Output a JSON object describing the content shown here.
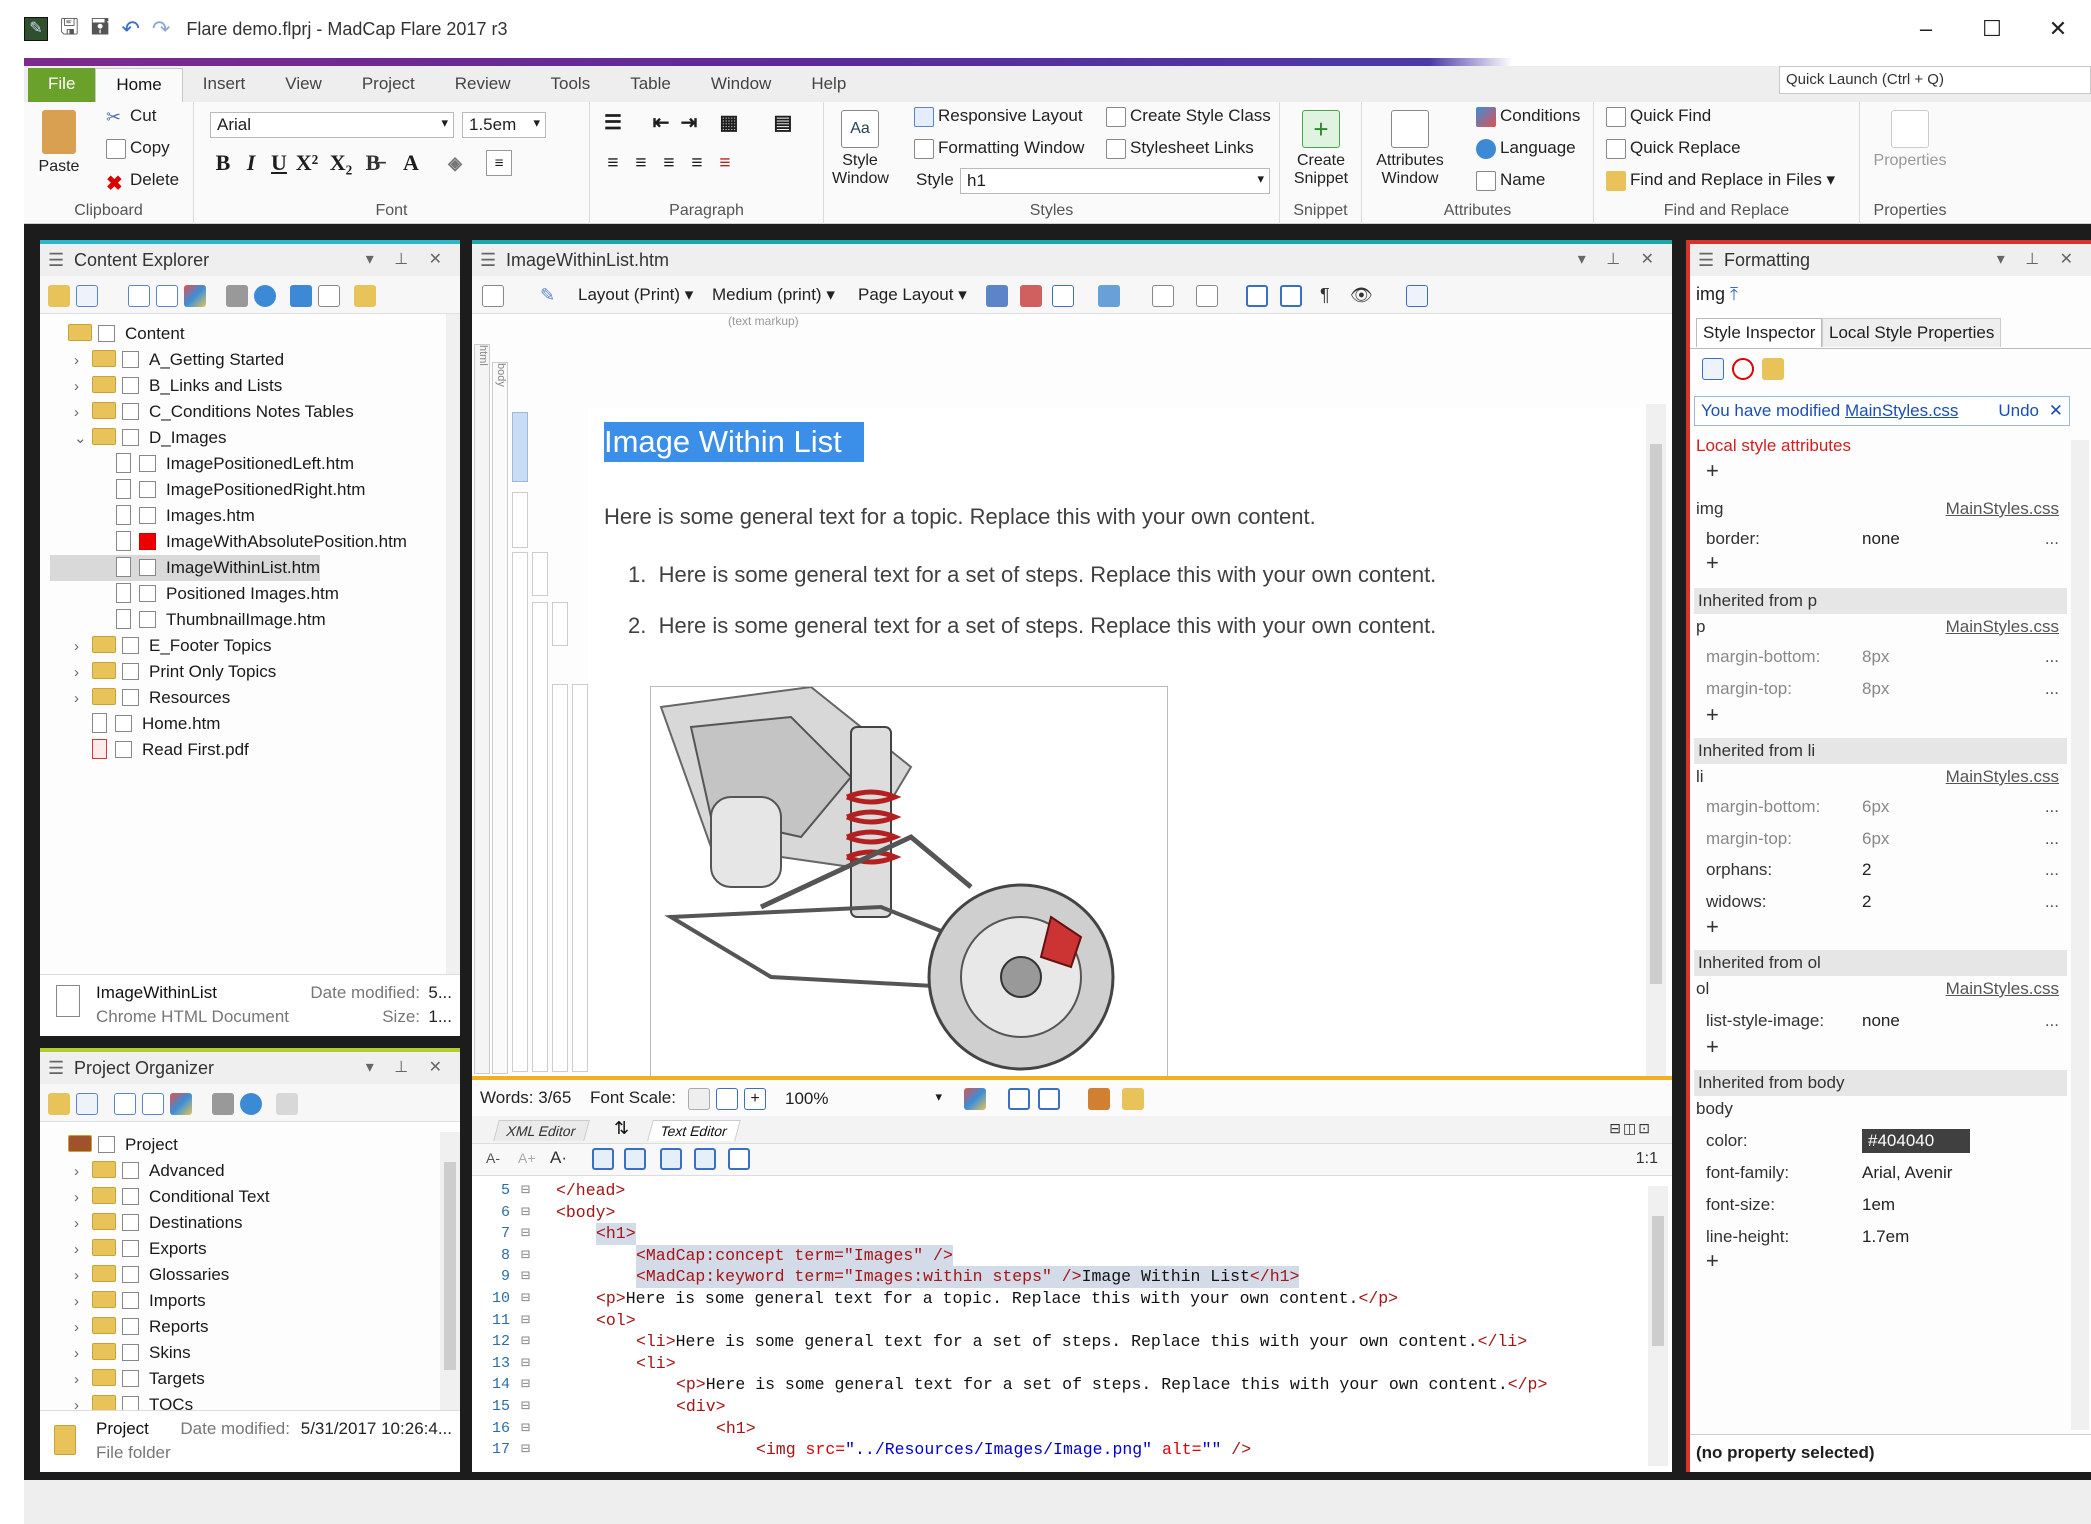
{
  "window": {
    "title": "Flare demo.flprj - MadCap Flare 2017 r3",
    "min": "–",
    "max": "☐",
    "close": "✕"
  },
  "tabs": [
    "File",
    "Home",
    "Insert",
    "View",
    "Project",
    "Review",
    "Tools",
    "Table",
    "Window",
    "Help"
  ],
  "quick_launch": "Quick Launch (Ctrl + Q)",
  "ribbon": {
    "clipboard": {
      "paste": "Paste",
      "cut": "Cut",
      "copy": "Copy",
      "delete": "Delete",
      "label": "Clipboard"
    },
    "font": {
      "family": "Arial",
      "size": "1.5em",
      "label": "Font"
    },
    "paragraph": {
      "label": "Paragraph"
    },
    "styles": {
      "style_window": "Style Window",
      "responsive": "Responsive Layout",
      "formatting": "Formatting Window",
      "create_class": "Create Style Class",
      "stylesheet_links": "Stylesheet Links",
      "style_label": "Style",
      "style_value": "h1",
      "label": "Styles"
    },
    "snippet": {
      "create": "Create Snippet",
      "label": "Snippet"
    },
    "attributes": {
      "window": "Attributes Window",
      "conditions": "Conditions",
      "language": "Language",
      "name": "Name",
      "label": "Attributes"
    },
    "find": {
      "quick_find": "Quick Find",
      "quick_replace": "Quick Replace",
      "find_files": "Find and Replace in Files",
      "label": "Find and Replace"
    },
    "properties": {
      "btn": "Properties",
      "label": "Properties"
    }
  },
  "content_explorer": {
    "title": "Content Explorer",
    "items": [
      {
        "label": "Content",
        "type": "folder",
        "depth": 0,
        "tw": ""
      },
      {
        "label": "A_Getting Started",
        "type": "folder",
        "depth": 1,
        "tw": "›"
      },
      {
        "label": "B_Links and Lists",
        "type": "folder",
        "depth": 1,
        "tw": "›"
      },
      {
        "label": "C_Conditions Notes Tables",
        "type": "folder",
        "depth": 1,
        "tw": "›"
      },
      {
        "label": "D_Images",
        "type": "folder",
        "depth": 1,
        "tw": "⌄"
      },
      {
        "label": "ImagePositionedLeft.htm",
        "type": "doc",
        "depth": 2,
        "tw": ""
      },
      {
        "label": "ImagePositionedRight.htm",
        "type": "doc",
        "depth": 2,
        "tw": ""
      },
      {
        "label": "Images.htm",
        "type": "doc",
        "depth": 2,
        "tw": ""
      },
      {
        "label": "ImageWithAbsolutePosition.htm",
        "type": "doc",
        "depth": 2,
        "tw": "",
        "red": true
      },
      {
        "label": "ImageWithinList.htm",
        "type": "doc",
        "depth": 2,
        "tw": "",
        "selected": true
      },
      {
        "label": "Positioned Images.htm",
        "type": "doc",
        "depth": 2,
        "tw": ""
      },
      {
        "label": "ThumbnailImage.htm",
        "type": "doc",
        "depth": 2,
        "tw": ""
      },
      {
        "label": "E_Footer Topics",
        "type": "folder",
        "depth": 1,
        "tw": "›"
      },
      {
        "label": "Print Only Topics",
        "type": "folder",
        "depth": 1,
        "tw": "›"
      },
      {
        "label": "Resources",
        "type": "folder",
        "depth": 1,
        "tw": "›"
      },
      {
        "label": "Home.htm",
        "type": "doc",
        "depth": 1,
        "tw": ""
      },
      {
        "label": "Read First.pdf",
        "type": "pdf",
        "depth": 1,
        "tw": ""
      }
    ],
    "footer": {
      "name": "ImageWithinList",
      "type": "Chrome HTML Document",
      "date_label": "Date modified:",
      "date_value": "5...",
      "size_label": "Size:",
      "size_value": "1..."
    }
  },
  "project_organizer": {
    "title": "Project Organizer",
    "items": [
      {
        "label": "Project",
        "type": "project",
        "depth": 0,
        "tw": ""
      },
      {
        "label": "Advanced",
        "type": "folder",
        "depth": 1,
        "tw": "›"
      },
      {
        "label": "Conditional Text",
        "type": "folder",
        "depth": 1,
        "tw": "›"
      },
      {
        "label": "Destinations",
        "type": "folder",
        "depth": 1,
        "tw": "›"
      },
      {
        "label": "Exports",
        "type": "folder",
        "depth": 1,
        "tw": "›"
      },
      {
        "label": "Glossaries",
        "type": "folder",
        "depth": 1,
        "tw": "›"
      },
      {
        "label": "Imports",
        "type": "folder",
        "depth": 1,
        "tw": "›"
      },
      {
        "label": "Reports",
        "type": "folder",
        "depth": 1,
        "tw": "›"
      },
      {
        "label": "Skins",
        "type": "folder",
        "depth": 1,
        "tw": "›"
      },
      {
        "label": "Targets",
        "type": "folder",
        "depth": 1,
        "tw": "›"
      },
      {
        "label": "TOCs",
        "type": "folder",
        "depth": 1,
        "tw": "›"
      }
    ],
    "footer": {
      "name": "Project",
      "type": "File folder",
      "date_label": "Date modified:",
      "date_value": "5/31/2017 10:26:4..."
    }
  },
  "editor": {
    "title": "ImageWithinList.htm",
    "layout": "Layout (Print)",
    "medium": "Medium (print)",
    "page_layout": "Page Layout",
    "markup": "(text markup)",
    "struct_html": "html",
    "struct_body": "body",
    "heading": "Image Within List",
    "para": "Here is some general text for a topic. Replace this with your own content.",
    "steps": [
      "Here is some general text for a set of steps. Replace this with your own content.",
      "Here is some general text for a set of steps. Replace this with your own content."
    ],
    "words": "Words: 3/65",
    "font_scale": "Font Scale:",
    "zoom": "100%",
    "xml_tab": "XML Editor",
    "text_tab": "Text Editor",
    "pos": "1:1"
  },
  "code": [
    {
      "n": "5",
      "indent": 0,
      "parts": [
        [
          "tag",
          "</head>"
        ]
      ]
    },
    {
      "n": "6",
      "indent": 0,
      "parts": [
        [
          "tag",
          "<body>"
        ]
      ]
    },
    {
      "n": "7",
      "indent": 1,
      "parts": [
        [
          "tag",
          "<h1>"
        ]
      ],
      "hl": true
    },
    {
      "n": "8",
      "indent": 2,
      "parts": [
        [
          "tag",
          "<MadCap:concept term=\"Images\" />"
        ]
      ],
      "hl": true
    },
    {
      "n": "9",
      "indent": 2,
      "parts": [
        [
          "tag",
          "<MadCap:keyword term=\"Images:within steps\" />"
        ],
        [
          "txt",
          "Image Within List"
        ],
        [
          "tag",
          "</h1>"
        ]
      ],
      "hl": true
    },
    {
      "n": "10",
      "indent": 1,
      "parts": [
        [
          "tag",
          "<p>"
        ],
        [
          "txt",
          "Here is some general text for a topic. Replace this with your own content."
        ],
        [
          "tag",
          "</p>"
        ]
      ]
    },
    {
      "n": "11",
      "indent": 1,
      "parts": [
        [
          "tag",
          "<ol>"
        ]
      ]
    },
    {
      "n": "12",
      "indent": 2,
      "parts": [
        [
          "tag",
          "<li>"
        ],
        [
          "txt",
          "Here is some general text for a set of steps. Replace this with your own content."
        ],
        [
          "tag",
          "</li>"
        ]
      ]
    },
    {
      "n": "13",
      "indent": 2,
      "parts": [
        [
          "tag",
          "<li>"
        ]
      ]
    },
    {
      "n": "14",
      "indent": 3,
      "parts": [
        [
          "tag",
          "<p>"
        ],
        [
          "txt",
          "Here is some general text for a set of steps. Replace this with your own content."
        ],
        [
          "tag",
          "</p>"
        ]
      ]
    },
    {
      "n": "15",
      "indent": 3,
      "parts": [
        [
          "tag",
          "<div>"
        ]
      ]
    },
    {
      "n": "16",
      "indent": 4,
      "parts": [
        [
          "tag",
          "<h1>"
        ]
      ]
    },
    {
      "n": "17",
      "indent": 5,
      "parts": [
        [
          "tag",
          "<img "
        ],
        [
          "attr",
          "src="
        ],
        [
          "val",
          "\"../Resources/Images/Image.png\""
        ],
        [
          "attr",
          " alt="
        ],
        [
          "val",
          "\"\""
        ],
        [
          "tag",
          " />"
        ]
      ]
    }
  ],
  "formatting": {
    "title": "Formatting",
    "element": "img",
    "tab1": "Style Inspector",
    "tab2": "Local Style Properties",
    "modified_text": "You have modified",
    "modified_link": "MainStyles.css",
    "undo": "Undo",
    "local": "Local style attributes",
    "img_label": "img",
    "css": "MainStyles.css",
    "border_k": "border:",
    "border_v": "none",
    "inh_p": "Inherited from p",
    "p": "p",
    "mb_k": "margin-bottom:",
    "mb_v": "8px",
    "mt_k": "margin-top:",
    "mt_v": "8px",
    "inh_li": "Inherited from li",
    "li": "li",
    "limb_v": "6px",
    "limt_v": "6px",
    "orph_k": "orphans:",
    "orph_v": "2",
    "wid_k": "widows:",
    "wid_v": "2",
    "inh_ol": "Inherited from ol",
    "ol": "ol",
    "lsi_k": "list-style-image:",
    "lsi_v": "none",
    "inh_body": "Inherited from body",
    "body": "body",
    "color_k": "color:",
    "color_v": "#404040",
    "ff_k": "font-family:",
    "ff_v": "Arial, Avenir",
    "fs_k": "font-size:",
    "fs_v": "1em",
    "lh_k": "line-height:",
    "lh_v": "1.7em",
    "dots": "...",
    "plus": "+",
    "no_prop": "(no property selected)"
  },
  "colors": {
    "accent_file": "#6aa12a",
    "ce_border": "#2bb7c9",
    "editor_border": "#1aa7a7",
    "fmt_border": "#d9342b",
    "po_border": "#b5cc2e",
    "text_border": "#f0b020"
  }
}
